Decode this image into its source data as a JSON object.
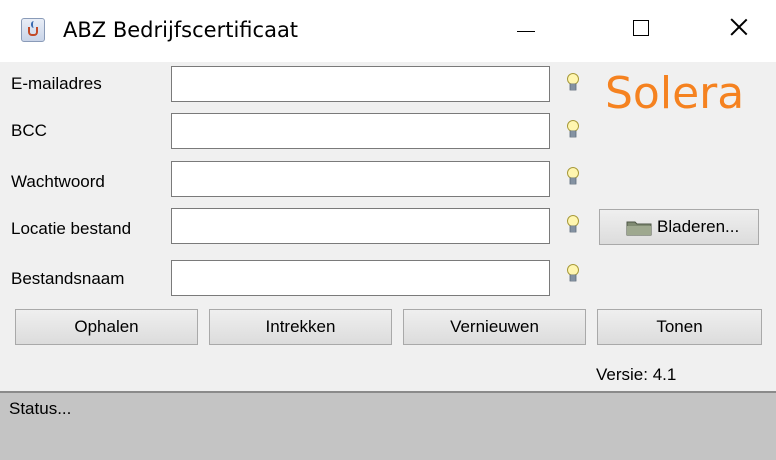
{
  "window": {
    "title": "ABZ Bedrijfscertificaat",
    "icon": "java-cup-icon",
    "controls": [
      "minimize",
      "maximize",
      "close"
    ]
  },
  "form": {
    "fields": [
      {
        "label": "E-mailadres",
        "value": "",
        "hint_icon": "lightbulb-icon"
      },
      {
        "label": "BCC",
        "value": "",
        "hint_icon": "lightbulb-icon"
      },
      {
        "label": "Wachtwoord",
        "value": "",
        "hint_icon": "lightbulb-icon"
      },
      {
        "label": "Locatie bestand",
        "value": "",
        "hint_icon": "lightbulb-icon"
      },
      {
        "label": "Bestandsnaam",
        "value": "",
        "hint_icon": "lightbulb-icon"
      }
    ],
    "browse_button": "Bladeren..."
  },
  "logo": {
    "text": "Solera",
    "color": "#f58220"
  },
  "actions": {
    "fetch": "Ophalen",
    "revoke": "Intrekken",
    "renew": "Vernieuwen",
    "show": "Tonen"
  },
  "version": "Versie: 4.1",
  "status": "Status..."
}
